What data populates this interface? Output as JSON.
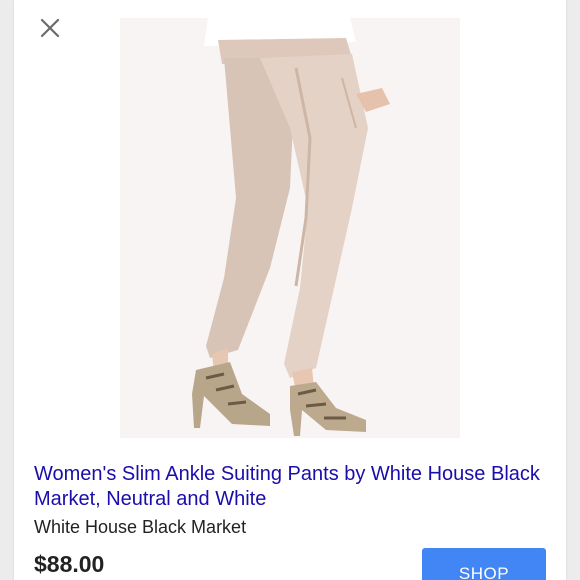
{
  "dialog": {
    "close_icon": "close-icon",
    "image_alt": "product-image"
  },
  "product": {
    "title": "Women's Slim Ankle Suiting Pants by White House Black Market, Neutral and White",
    "seller": "White House Black Market",
    "price": "$88.00"
  },
  "actions": {
    "shop_label": "SHOP"
  },
  "colors": {
    "link": "#1a0dab",
    "button": "#4285f4",
    "pants": "#e2cfc2",
    "background": "#ececec"
  }
}
